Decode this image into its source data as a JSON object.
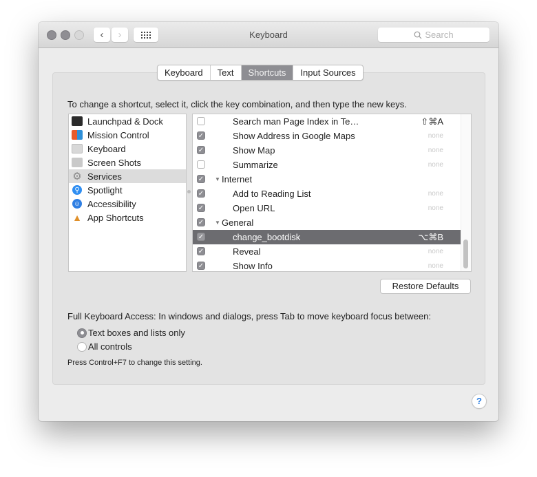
{
  "window": {
    "title": "Keyboard",
    "search_placeholder": "Search"
  },
  "tabs": [
    {
      "label": "Keyboard",
      "active": false
    },
    {
      "label": "Text",
      "active": false
    },
    {
      "label": "Shortcuts",
      "active": true
    },
    {
      "label": "Input Sources",
      "active": false
    }
  ],
  "instructions": "To change a shortcut, select it, click the key combination, and then type the new keys.",
  "categories": [
    {
      "label": "Launchpad & Dock",
      "icon": "launchpad-icon"
    },
    {
      "label": "Mission Control",
      "icon": "mission-control-icon"
    },
    {
      "label": "Keyboard",
      "icon": "keyboard-icon"
    },
    {
      "label": "Screen Shots",
      "icon": "screenshot-icon"
    },
    {
      "label": "Services",
      "icon": "gear-icon",
      "selected": true
    },
    {
      "label": "Spotlight",
      "icon": "spotlight-icon"
    },
    {
      "label": "Accessibility",
      "icon": "accessibility-icon"
    },
    {
      "label": "App Shortcuts",
      "icon": "app-shortcuts-icon"
    }
  ],
  "shortcuts": [
    {
      "label": "Search man Page Index in Te…",
      "checked": false,
      "key": "⇧⌘A",
      "group": false
    },
    {
      "label": "Show Address in Google Maps",
      "checked": true,
      "key": "none",
      "group": false
    },
    {
      "label": "Show Map",
      "checked": true,
      "key": "none",
      "group": false
    },
    {
      "label": "Summarize",
      "checked": false,
      "key": "none",
      "group": false
    },
    {
      "label": "Internet",
      "checked": true,
      "key": "",
      "group": true
    },
    {
      "label": "Add to Reading List",
      "checked": true,
      "key": "none",
      "group": false
    },
    {
      "label": "Open URL",
      "checked": true,
      "key": "none",
      "group": false
    },
    {
      "label": "General",
      "checked": true,
      "key": "",
      "group": true
    },
    {
      "label": "change_bootdisk",
      "checked": true,
      "key": "⌥⌘B",
      "group": false,
      "selected": true
    },
    {
      "label": "Reveal",
      "checked": true,
      "key": "none",
      "group": false
    },
    {
      "label": "Show Info",
      "checked": true,
      "key": "none",
      "group": false
    }
  ],
  "restore_defaults_label": "Restore Defaults",
  "full_keyboard_access": {
    "label": "Full Keyboard Access: In windows and dialogs, press Tab to move keyboard focus between:",
    "options": [
      {
        "label": "Text boxes and lists only",
        "selected": true
      },
      {
        "label": "All controls",
        "selected": false
      }
    ],
    "hint": "Press Control+F7 to change this setting."
  },
  "help_label": "?"
}
